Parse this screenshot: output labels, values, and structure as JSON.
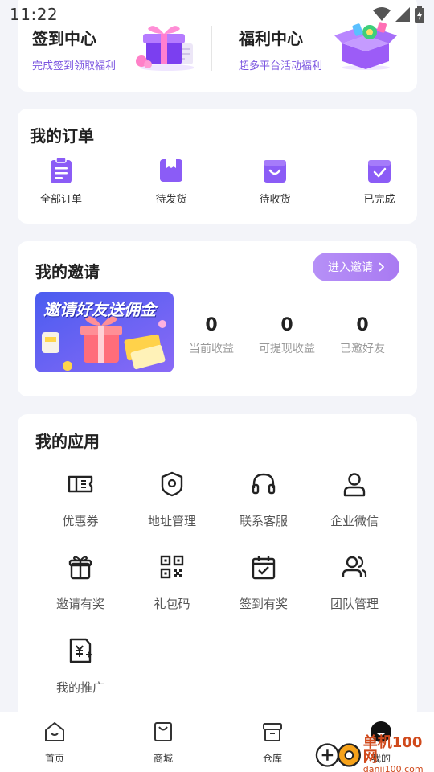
{
  "status_bar": {
    "time": "11:22"
  },
  "promos": [
    {
      "title": "签到中心",
      "subtitle": "完成签到领取福利"
    },
    {
      "title": "福利中心",
      "subtitle": "超多平台活动福利"
    }
  ],
  "orders": {
    "title": "我的订单",
    "items": [
      {
        "label": "全部订单",
        "icon": "clipboard-icon"
      },
      {
        "label": "待发货",
        "icon": "box-icon"
      },
      {
        "label": "待收货",
        "icon": "shopping-bag-icon"
      },
      {
        "label": "已完成",
        "icon": "check-box-icon"
      }
    ]
  },
  "invite": {
    "title": "我的邀请",
    "button_label": "进入邀请",
    "banner_text": "邀请好友送佣金",
    "stats": [
      {
        "value": "0",
        "label": "当前收益"
      },
      {
        "value": "0",
        "label": "可提现收益"
      },
      {
        "value": "0",
        "label": "已邀好友"
      }
    ]
  },
  "apps": {
    "title": "我的应用",
    "items": [
      {
        "label": "优惠券",
        "icon": "ticket-icon"
      },
      {
        "label": "地址管理",
        "icon": "location-icon"
      },
      {
        "label": "联系客服",
        "icon": "headset-icon"
      },
      {
        "label": "企业微信",
        "icon": "user-icon"
      },
      {
        "label": "邀请有奖",
        "icon": "gift-icon"
      },
      {
        "label": "礼包码",
        "icon": "qr-code-icon"
      },
      {
        "label": "签到有奖",
        "icon": "calendar-check-icon"
      },
      {
        "label": "团队管理",
        "icon": "team-icon"
      },
      {
        "label": "我的推广",
        "icon": "promotion-icon"
      }
    ]
  },
  "bottom_nav": [
    {
      "label": "首页",
      "icon": "home-icon"
    },
    {
      "label": "商城",
      "icon": "shop-bag-icon"
    },
    {
      "label": "仓库",
      "icon": "warehouse-icon"
    },
    {
      "label": "我的",
      "icon": "profile-icon"
    }
  ],
  "watermark": {
    "line1": "单机100网",
    "line2": "danji100.com"
  },
  "colors": {
    "accent": "#8b5cf6",
    "promo_subtitle": "#7b55e0",
    "background": "#f3f4f9"
  }
}
